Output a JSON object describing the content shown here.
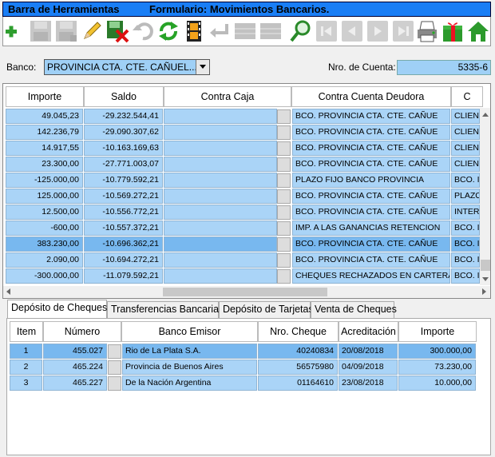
{
  "title_bar": {
    "left": "Barra de Herramientas",
    "right": "Formulario: Movimientos Bancarios."
  },
  "toolbar": {
    "buttons": [
      {
        "icon": "add-icon",
        "enabled": true
      },
      {
        "icon": "save-icon",
        "enabled": false
      },
      {
        "icon": "save-as-icon",
        "enabled": false
      },
      {
        "icon": "edit-pencil-icon",
        "enabled": true
      },
      {
        "icon": "delete-icon",
        "enabled": true
      },
      {
        "icon": "undo-icon",
        "enabled": false
      },
      {
        "icon": "refresh-icon",
        "enabled": true
      },
      {
        "icon": "film-icon",
        "enabled": true
      },
      {
        "icon": "enter-icon",
        "enabled": false
      },
      {
        "icon": "grid-icon",
        "enabled": false
      },
      {
        "icon": "list-icon",
        "enabled": false
      },
      {
        "icon": "search-icon",
        "enabled": true
      },
      {
        "icon": "first-record-icon",
        "enabled": false
      },
      {
        "icon": "previous-record-icon",
        "enabled": false
      },
      {
        "icon": "next-record-icon",
        "enabled": false
      },
      {
        "icon": "last-record-icon",
        "enabled": false
      },
      {
        "icon": "print-icon",
        "enabled": true
      },
      {
        "icon": "gift-icon",
        "enabled": true
      },
      {
        "icon": "home-icon",
        "enabled": true
      }
    ]
  },
  "header": {
    "banco_label": "Banco:",
    "banco_value": "PROVINCIA CTA. CTE. CAÑUEL...",
    "cuenta_label": "Nro. de Cuenta:",
    "cuenta_value": "5335-6"
  },
  "movimientos": {
    "columns": [
      "Importe",
      "Saldo",
      "Contra Caja",
      "Contra Cuenta Deudora",
      "C"
    ],
    "rows": [
      {
        "importe": "49.045,23",
        "saldo": "-29.232.544,41",
        "contra_caja": "",
        "deudora": "BCO. PROVINCIA CTA. CTE. CAÑUE",
        "extra": "CLIEN"
      },
      {
        "importe": "142.236,79",
        "saldo": "-29.090.307,62",
        "contra_caja": "",
        "deudora": "BCO. PROVINCIA CTA. CTE. CAÑUE",
        "extra": "CLIEN"
      },
      {
        "importe": "14.917,55",
        "saldo": "-10.163.169,63",
        "contra_caja": "",
        "deudora": "BCO. PROVINCIA CTA. CTE. CAÑUE",
        "extra": "CLIEN"
      },
      {
        "importe": "23.300,00",
        "saldo": "-27.771.003,07",
        "contra_caja": "",
        "deudora": "BCO. PROVINCIA CTA. CTE. CAÑUE",
        "extra": "CLIEN"
      },
      {
        "importe": "-125.000,00",
        "saldo": "-10.779.592,21",
        "contra_caja": "",
        "deudora": "PLAZO FIJO BANCO PROVINCIA",
        "extra": "BCO. I"
      },
      {
        "importe": "125.000,00",
        "saldo": "-10.569.272,21",
        "contra_caja": "",
        "deudora": "BCO. PROVINCIA CTA. CTE. CAÑUE",
        "extra": "PLAZO"
      },
      {
        "importe": "12.500,00",
        "saldo": "-10.556.772,21",
        "contra_caja": "",
        "deudora": "BCO. PROVINCIA CTA. CTE. CAÑUE",
        "extra": "INTER"
      },
      {
        "importe": "-600,00",
        "saldo": "-10.557.372,21",
        "contra_caja": "",
        "deudora": "IMP. A LAS GANANCIAS RETENCION",
        "extra": "BCO. I"
      },
      {
        "importe": "383.230,00",
        "saldo": "-10.696.362,21",
        "contra_caja": "",
        "deudora": "BCO. PROVINCIA CTA. CTE. CAÑUE",
        "extra": "BCO. I"
      },
      {
        "importe": "2.090,00",
        "saldo": "-10.694.272,21",
        "contra_caja": "",
        "deudora": "BCO. PROVINCIA CTA. CTE. CAÑUE",
        "extra": "BCO. I"
      },
      {
        "importe": "-300.000,00",
        "saldo": "-11.079.592,21",
        "contra_caja": "",
        "deudora": "CHEQUES RECHAZADOS EN CARTERA",
        "extra": "BCO. I"
      }
    ]
  },
  "tabs": [
    "Depósito de Cheques",
    "Transferencias Bancarias",
    "Depósito de Tarjetas",
    "Venta de Cheques"
  ],
  "cheques": {
    "columns": [
      "Item",
      "Número",
      "Banco Emisor",
      "Nro. Cheque",
      "Acreditación",
      "Importe"
    ],
    "rows": [
      {
        "item": "1",
        "numero": "455.027",
        "banco": "Rio de La Plata S.A.",
        "nro_cheque": "40240834",
        "acreditacion": "20/08/2018",
        "importe": "300.000,00"
      },
      {
        "item": "2",
        "numero": "465.224",
        "banco": "Provincia de Buenos Aires",
        "nro_cheque": "56575980",
        "acreditacion": "04/09/2018",
        "importe": "73.230,00"
      },
      {
        "item": "3",
        "numero": "465.227",
        "banco": "De la Nación Argentina",
        "nro_cheque": "01164610",
        "acreditacion": "23/08/2018",
        "importe": "10.000,00"
      }
    ]
  },
  "colors": {
    "title_bar": "#1a7ef5",
    "cell": "#aad4f7",
    "selected_cell": "#78b8ef"
  }
}
